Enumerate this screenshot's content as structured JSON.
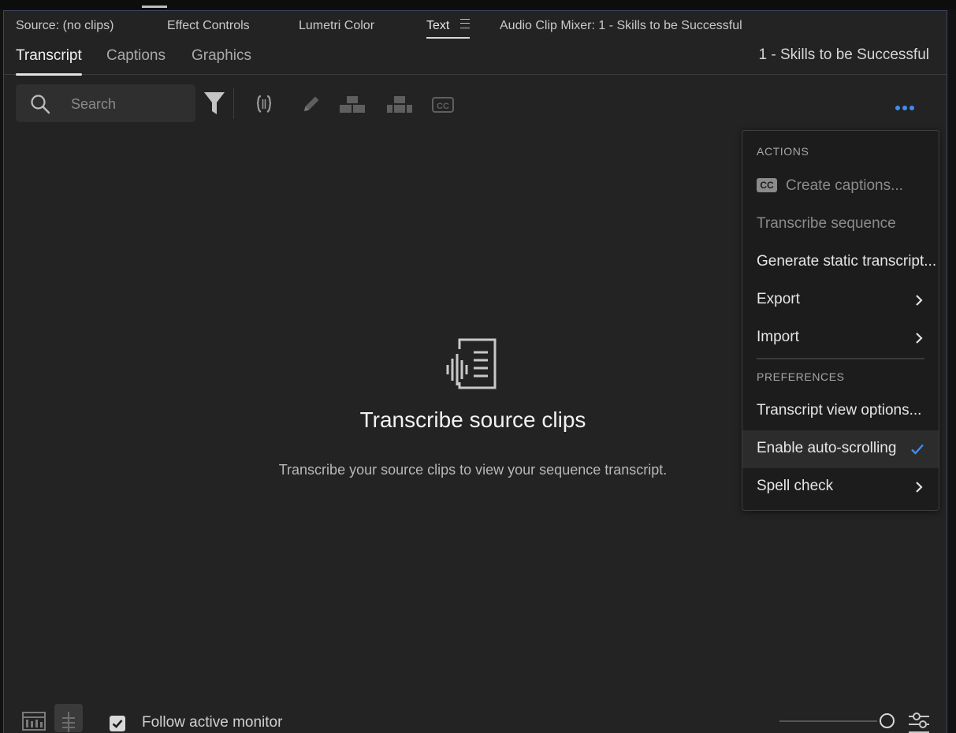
{
  "panel_tabs": [
    {
      "label": "Source: (no clips)",
      "active": false
    },
    {
      "label": "Effect Controls",
      "active": false
    },
    {
      "label": "Lumetri Color",
      "active": false
    },
    {
      "label": "Text",
      "active": true
    },
    {
      "label": "Audio Clip Mixer: 1 - Skills to be Successful",
      "active": false
    }
  ],
  "sub_tabs": [
    {
      "label": "Transcript",
      "active": true
    },
    {
      "label": "Captions",
      "active": false
    },
    {
      "label": "Graphics",
      "active": false
    }
  ],
  "sequence_name": "1 - Skills to be Successful",
  "search": {
    "placeholder": "Search",
    "value": ""
  },
  "toolbar_icons": [
    "filter-icon",
    "merge-segments-icon",
    "edit-pencil-icon",
    "split-segment-icon",
    "join-segments-icon",
    "captions-cc-icon",
    "more-options-icon"
  ],
  "empty_state": {
    "icon": "transcript-waveform-icon",
    "title": "Transcribe source clips",
    "description": "Transcribe your source clips to view your sequence transcript."
  },
  "menu": {
    "actions_header": "ACTIONS",
    "items_actions": [
      {
        "label": "Create captions...",
        "disabled": true,
        "icon": "cc-badge",
        "badge": "CC"
      },
      {
        "label": "Transcribe sequence",
        "disabled": true
      },
      {
        "label": "Generate static transcript...",
        "disabled": false
      },
      {
        "label": "Export",
        "disabled": false,
        "submenu": true
      },
      {
        "label": "Import",
        "disabled": false,
        "submenu": true
      }
    ],
    "preferences_header": "PREFERENCES",
    "items_preferences": [
      {
        "label": "Transcript view options...",
        "disabled": false
      },
      {
        "label": "Enable auto-scrolling",
        "checked": true,
        "highlighted": true
      },
      {
        "label": "Spell check",
        "submenu": true
      }
    ]
  },
  "footer": {
    "follow_label": "Follow active monitor",
    "follow_checked": true
  },
  "colors": {
    "accent": "#3f8df0",
    "panel_bg": "#232323",
    "menu_bg": "#1c1c1c"
  }
}
